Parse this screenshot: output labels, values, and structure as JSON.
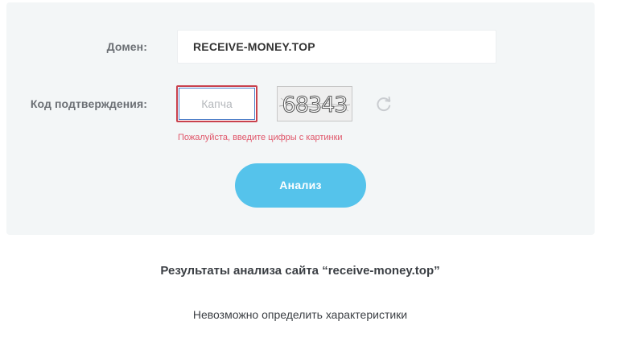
{
  "form": {
    "domain_label": "Домен:",
    "domain_value": "RECEIVE-MONEY.TOP",
    "captcha_label": "Код подтверждения:",
    "captcha_placeholder": "Капча",
    "captcha_image_text": "68343",
    "captcha_error": "Пожалуйста, введите цифры с картинки",
    "analyze_button": "Анализ",
    "refresh_icon": "refresh-icon"
  },
  "results": {
    "title": "Результаты анализа сайта “receive-money.top”",
    "message": "Невозможно определить характеристики"
  },
  "colors": {
    "panel_bg": "#f3f6f7",
    "button_bg": "#55c3eb",
    "error": "#e0566a",
    "input_error_border": "#c9414d"
  }
}
